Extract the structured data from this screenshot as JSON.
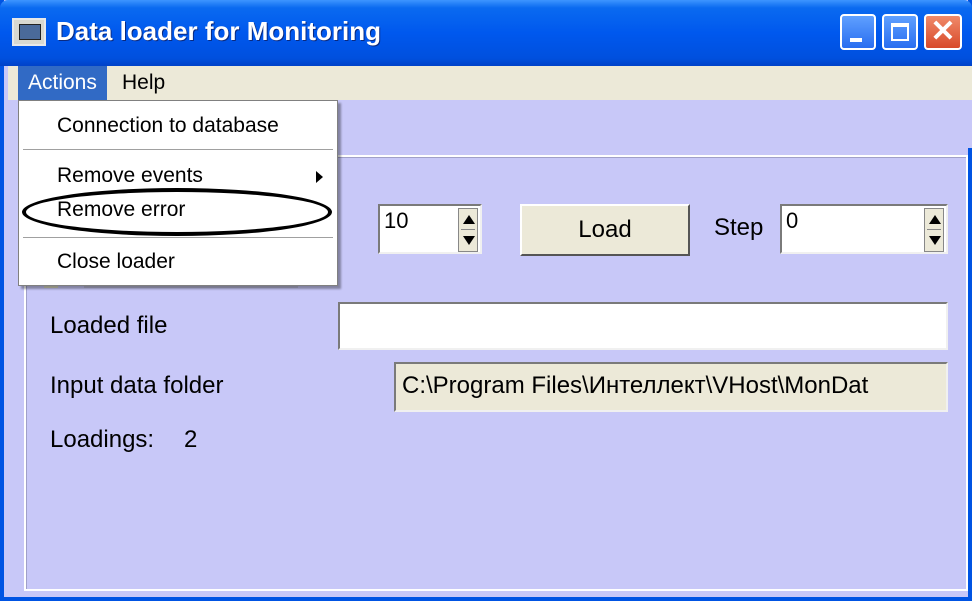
{
  "window": {
    "title": "Data loader for Monitoring",
    "icon": "monitor-app-icon"
  },
  "menubar": {
    "items": [
      {
        "label": "Actions"
      },
      {
        "label": "Help"
      }
    ]
  },
  "actions_menu": {
    "items": [
      {
        "label": "Connection to database"
      },
      {
        "label": "Remove events",
        "has_submenu": true
      },
      {
        "label": "Remove error",
        "highlighted": true
      },
      {
        "label": "Close loader"
      }
    ]
  },
  "controls": {
    "count_value": "10",
    "load_label": "Load",
    "step_label": "Step",
    "step_value": "0",
    "loaded_file_label": "Loaded file",
    "loaded_file_value": "",
    "input_folder_label": "Input data folder",
    "input_folder_value": "C:\\Program Files\\Интеллект\\VHost\\MonDat",
    "loadings_label": "Loadings:",
    "loadings_value": "2"
  },
  "colors": {
    "window_bg": "#c8c8f8",
    "titlebar": "#0058ee",
    "menu_highlight": "#316ac5",
    "close_button": "#d84a2a"
  }
}
